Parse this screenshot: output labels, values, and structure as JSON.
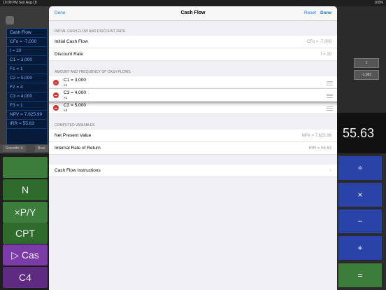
{
  "status": {
    "time_date": "10:09 PM  Sun Aug 18",
    "battery": "100%"
  },
  "background": {
    "registers": [
      "Cash Flow",
      "CFo = -7,000",
      "I = 20",
      "C1 = 3,000",
      "F1 = 1",
      "C2 = 5,000",
      "F2 = 4",
      "C3 = 4,000",
      "F3 = 1",
      "NPV = 7,625.99",
      "IRR = 55.63"
    ],
    "tabs": [
      "Scientific X",
      "Bran"
    ],
    "left_buttons": [
      "N",
      "×P/Y",
      "CPT",
      "▷ Cas",
      "C4"
    ],
    "small_fields": [
      "1",
      "-1,083"
    ],
    "display_value": "55.63",
    "right_buttons": [
      "÷",
      "×",
      "−",
      "+",
      "="
    ]
  },
  "modal": {
    "left_button": "Done",
    "title": "Cash Flow",
    "reset_button": "Reset",
    "done_button": "Done",
    "section1": "INITIAL CASH FLOW AND DISCOUNT RATE",
    "initial_cash_flow": {
      "label": "Initial Cash Flow",
      "value": "CFo = -7,000"
    },
    "discount_rate": {
      "label": "Discount Rate",
      "value": "I = 20"
    },
    "section2": "AMOUNT AND FREQUENCY OF CASH FLOWS",
    "cash_flows": [
      {
        "main": "C1 = 3,000",
        "sub": "×1"
      },
      {
        "main": "C3 = 4,000",
        "sub": "×1"
      },
      {
        "main": "C2 = 5,000",
        "sub": "×4"
      }
    ],
    "section3": "COMPUTED VARIABLES",
    "npv": {
      "label": "Net Present Value",
      "value": "NPV = 7,625.99"
    },
    "irr": {
      "label": "Internal Rate of Return",
      "value": "IRR = 55.63"
    },
    "instructions": {
      "label": "Cash Flow Instructions",
      "chevron": "›"
    }
  }
}
